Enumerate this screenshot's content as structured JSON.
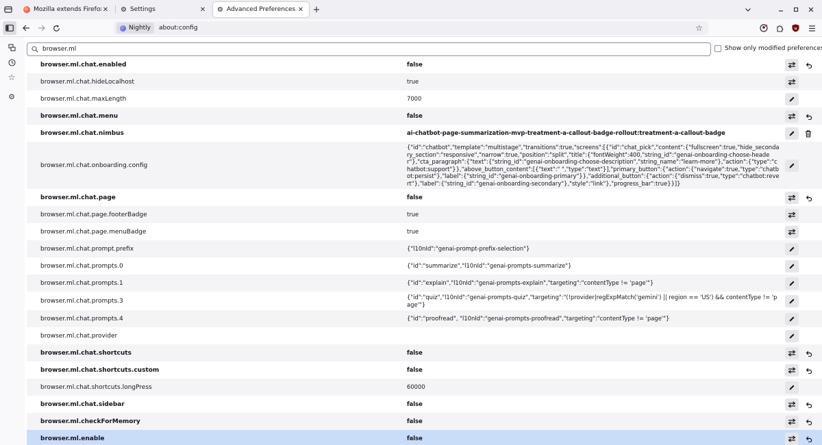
{
  "tabs": [
    {
      "title": "Mozilla extends Firefox ESR",
      "icon": "firefox-favicon-icon",
      "active": false
    },
    {
      "title": "Settings",
      "icon": "gear-icon",
      "active": false
    },
    {
      "title": "Advanced Preferences",
      "icon": "gear-icon",
      "active": true
    }
  ],
  "navbar": {
    "identity_label": "Nightly",
    "url": "about:config"
  },
  "search": {
    "value": "browser.ml",
    "modified_label": "Show only modified preferences",
    "modified_checked": false
  },
  "prefs": [
    {
      "name": "browser.ml.chat.enabled",
      "value": "false",
      "modified": true,
      "type": "boolean"
    },
    {
      "name": "browser.ml.chat.hideLocalhost",
      "value": "true",
      "modified": false,
      "type": "boolean"
    },
    {
      "name": "browser.ml.chat.maxLength",
      "value": "7000",
      "modified": false,
      "type": "number"
    },
    {
      "name": "browser.ml.chat.menu",
      "value": "false",
      "modified": true,
      "type": "boolean"
    },
    {
      "name": "browser.ml.chat.nimbus",
      "value": "ai-chatbot-page-summarization-mvp-treatment-a-callout-badge-rollout:treatment-a-callout-badge",
      "modified": true,
      "type": "string-user"
    },
    {
      "name": "browser.ml.chat.onboarding.config",
      "value": "{\"id\":\"chatbot\",\"template\":\"multistage\",\"transitions\":true,\"screens\":[{\"id\":\"chat_pick\",\"content\":{\"fullscreen\":true,\"hide_secondary_section\":\"responsive\",\"narrow\":true,\"position\":\"split\",\"title\":{\"fontWeight\":400,\"string_id\":\"genai-onboarding-choose-header\"},\"cta_paragraph\":{\"text\":{\"string_id\":\"genai-onboarding-choose-description\",\"string_name\":\"learn-more\"},\"action\":{\"type\":\"chatbot:support\"}},\"above_button_content\":[{\"text\":\" \",\"type\":\"text\"}],\"primary_button\":{\"action\":{\"navigate\":true,\"type\":\"chatbot:persist\"},\"label\":{\"string_id\":\"genai-onboarding-primary\"}},\"additional_button\":{\"action\":{\"dismiss\":true,\"type\":\"chatbot:revert\"},\"label\":{\"string_id\":\"genai-onboarding-secondary\"},\"style\":\"link\"},\"progress_bar\":true}}]}",
      "modified": false,
      "type": "string"
    },
    {
      "name": "browser.ml.chat.page",
      "value": "false",
      "modified": true,
      "type": "boolean"
    },
    {
      "name": "browser.ml.chat.page.footerBadge",
      "value": "true",
      "modified": false,
      "type": "boolean"
    },
    {
      "name": "browser.ml.chat.page.menuBadge",
      "value": "true",
      "modified": false,
      "type": "boolean"
    },
    {
      "name": "browser.ml.chat.prompt.prefix",
      "value": "{\"l10nId\":\"genai-prompt-prefix-selection\"}",
      "modified": false,
      "type": "string"
    },
    {
      "name": "browser.ml.chat.prompts.0",
      "value": "{\"id\":\"summarize\",\"l10nId\":\"genai-prompts-summarize\"}",
      "modified": false,
      "type": "string"
    },
    {
      "name": "browser.ml.chat.prompts.1",
      "value": "{\"id\":\"explain\",\"l10nId\":\"genai-prompts-explain\",\"targeting\":\"contentType != 'page'\"}",
      "modified": false,
      "type": "string"
    },
    {
      "name": "browser.ml.chat.prompts.3",
      "value": "{\"id\":\"quiz\",\"l10nId\":\"genai-prompts-quiz\",\"targeting\":\"(!provider|regExpMatch('gemini') || region == 'US') && contentType != 'page'\"}",
      "modified": false,
      "type": "string"
    },
    {
      "name": "browser.ml.chat.prompts.4",
      "value": "{\"id\":\"proofread\", \"l10nId\":\"genai-prompts-proofread\",\"targeting\":\"contentType != 'page'\"}",
      "modified": false,
      "type": "string"
    },
    {
      "name": "browser.ml.chat.provider",
      "value": "",
      "modified": false,
      "type": "string"
    },
    {
      "name": "browser.ml.chat.shortcuts",
      "value": "false",
      "modified": true,
      "type": "boolean"
    },
    {
      "name": "browser.ml.chat.shortcuts.custom",
      "value": "false",
      "modified": true,
      "type": "boolean"
    },
    {
      "name": "browser.ml.chat.shortcuts.longPress",
      "value": "60000",
      "modified": false,
      "type": "number"
    },
    {
      "name": "browser.ml.chat.sidebar",
      "value": "false",
      "modified": true,
      "type": "boolean"
    },
    {
      "name": "browser.ml.checkForMemory",
      "value": "false",
      "modified": true,
      "type": "boolean"
    },
    {
      "name": "browser.ml.enable",
      "value": "false",
      "modified": true,
      "type": "boolean",
      "selected": true
    }
  ]
}
